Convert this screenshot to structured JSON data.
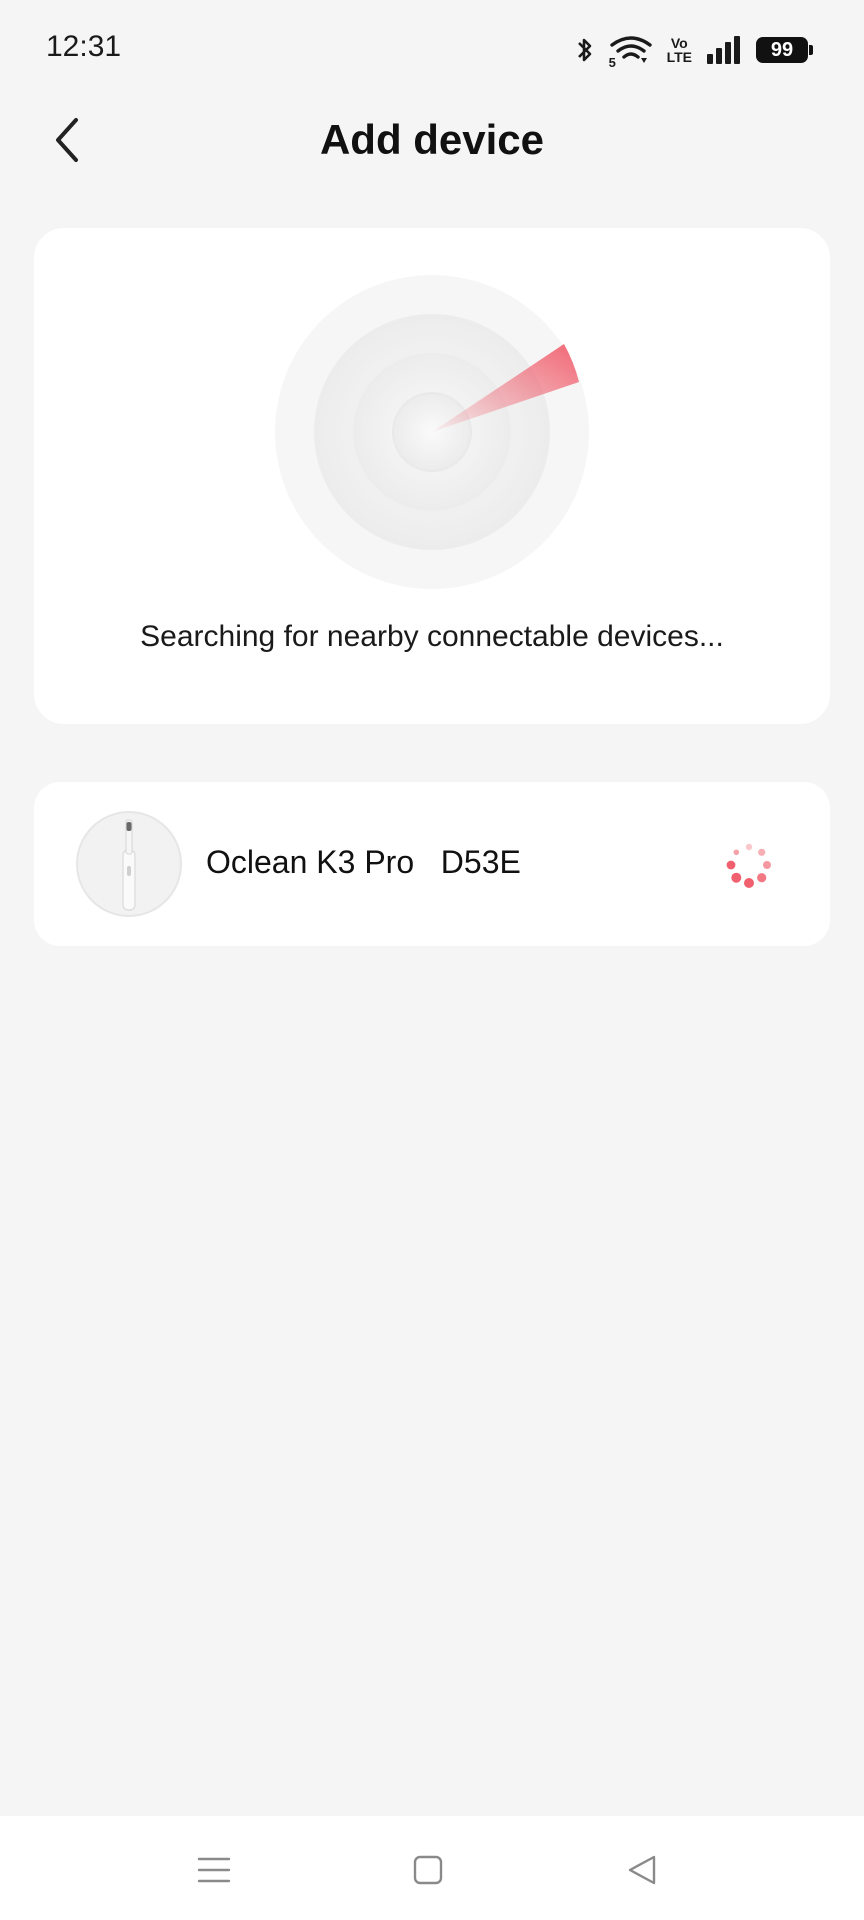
{
  "status_bar": {
    "time": "12:31",
    "battery": "99",
    "volte_top": "Vo",
    "volte_bottom": "LTE",
    "wifi_badge": "5",
    "icons": [
      "bluetooth-icon",
      "wifi-icon",
      "volte-icon",
      "signal-icon",
      "battery-icon"
    ]
  },
  "header": {
    "title": "Add device",
    "back_icon": "chevron-left-icon"
  },
  "search": {
    "status_text": "Searching for nearby connectable devices...",
    "accent_color": "#f0606e"
  },
  "devices": [
    {
      "name": "Oclean K3 Pro   D53E",
      "thumbnail": "toothbrush-icon",
      "status_icon": "loading-spinner-icon"
    }
  ],
  "nav_bar": {
    "items": [
      "menu-icon",
      "home-icon",
      "back-icon"
    ]
  }
}
